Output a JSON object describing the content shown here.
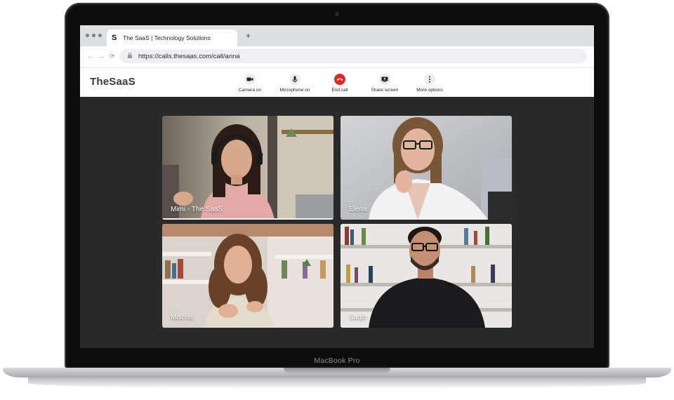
{
  "browser": {
    "tab": {
      "logo": "S",
      "title": "The SaaS | Technology Solutions"
    },
    "new_tab": "+",
    "nav": {
      "back": "←",
      "forward": "→",
      "reload": "⟳"
    },
    "url": "https://calls.thesaas.com/call/anna"
  },
  "app": {
    "brand": {
      "part1": "The",
      "part2": "SaaS"
    },
    "controls": [
      {
        "label": "Camera on",
        "icon": "camera-icon"
      },
      {
        "label": "Microphone on",
        "icon": "microphone-icon"
      },
      {
        "label": "End call",
        "icon": "end-call-icon",
        "color": "#d7282b"
      },
      {
        "label": "Share screen",
        "icon": "share-screen-icon"
      },
      {
        "label": "More options",
        "icon": "more-options-icon"
      }
    ]
  },
  "participants": [
    {
      "name": "Mimi - The SaaS",
      "active": true
    },
    {
      "name": "Elena",
      "active": false
    },
    {
      "name": "Mischa",
      "active": false
    },
    {
      "name": "Saqib",
      "active": false
    }
  ],
  "device": {
    "model": "MacBook Pro"
  },
  "colors": {
    "stage_bg": "#292929",
    "end_call": "#d7282b",
    "brand_text": "#3a3a3a"
  }
}
